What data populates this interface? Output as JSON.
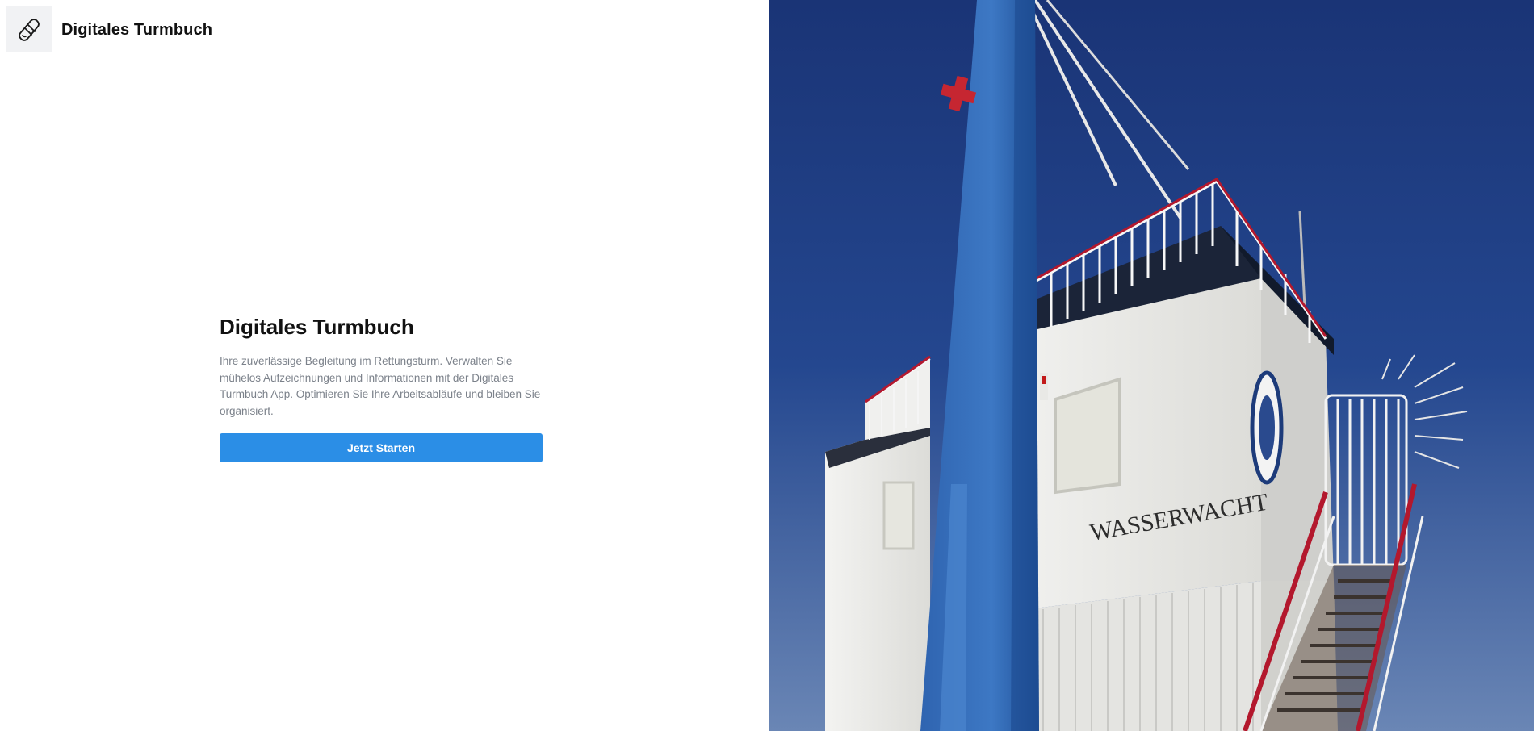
{
  "header": {
    "logo_icon": "lifebuoy-band-icon",
    "app_name": "Digitales Turmbuch"
  },
  "hero": {
    "title": "Digitales Turmbuch",
    "description": "Ihre zuverlässige Begleitung im Rettungsturm. Verwalten Sie mühelos Aufzeichnungen und Informationen mit der Digitales Turmbuch App. Optimieren Sie Ihre Arbeitsabläufe und bleiben Sie organisiert.",
    "start_label": "Jetzt Starten"
  },
  "image": {
    "subject": "lifeguard-tower-photo",
    "sign_text": "WASSERWACHT"
  },
  "colors": {
    "accent": "#2b8ee6",
    "sky": "#1e3f86",
    "text": "#111111",
    "muted_text": "#7b818a"
  }
}
